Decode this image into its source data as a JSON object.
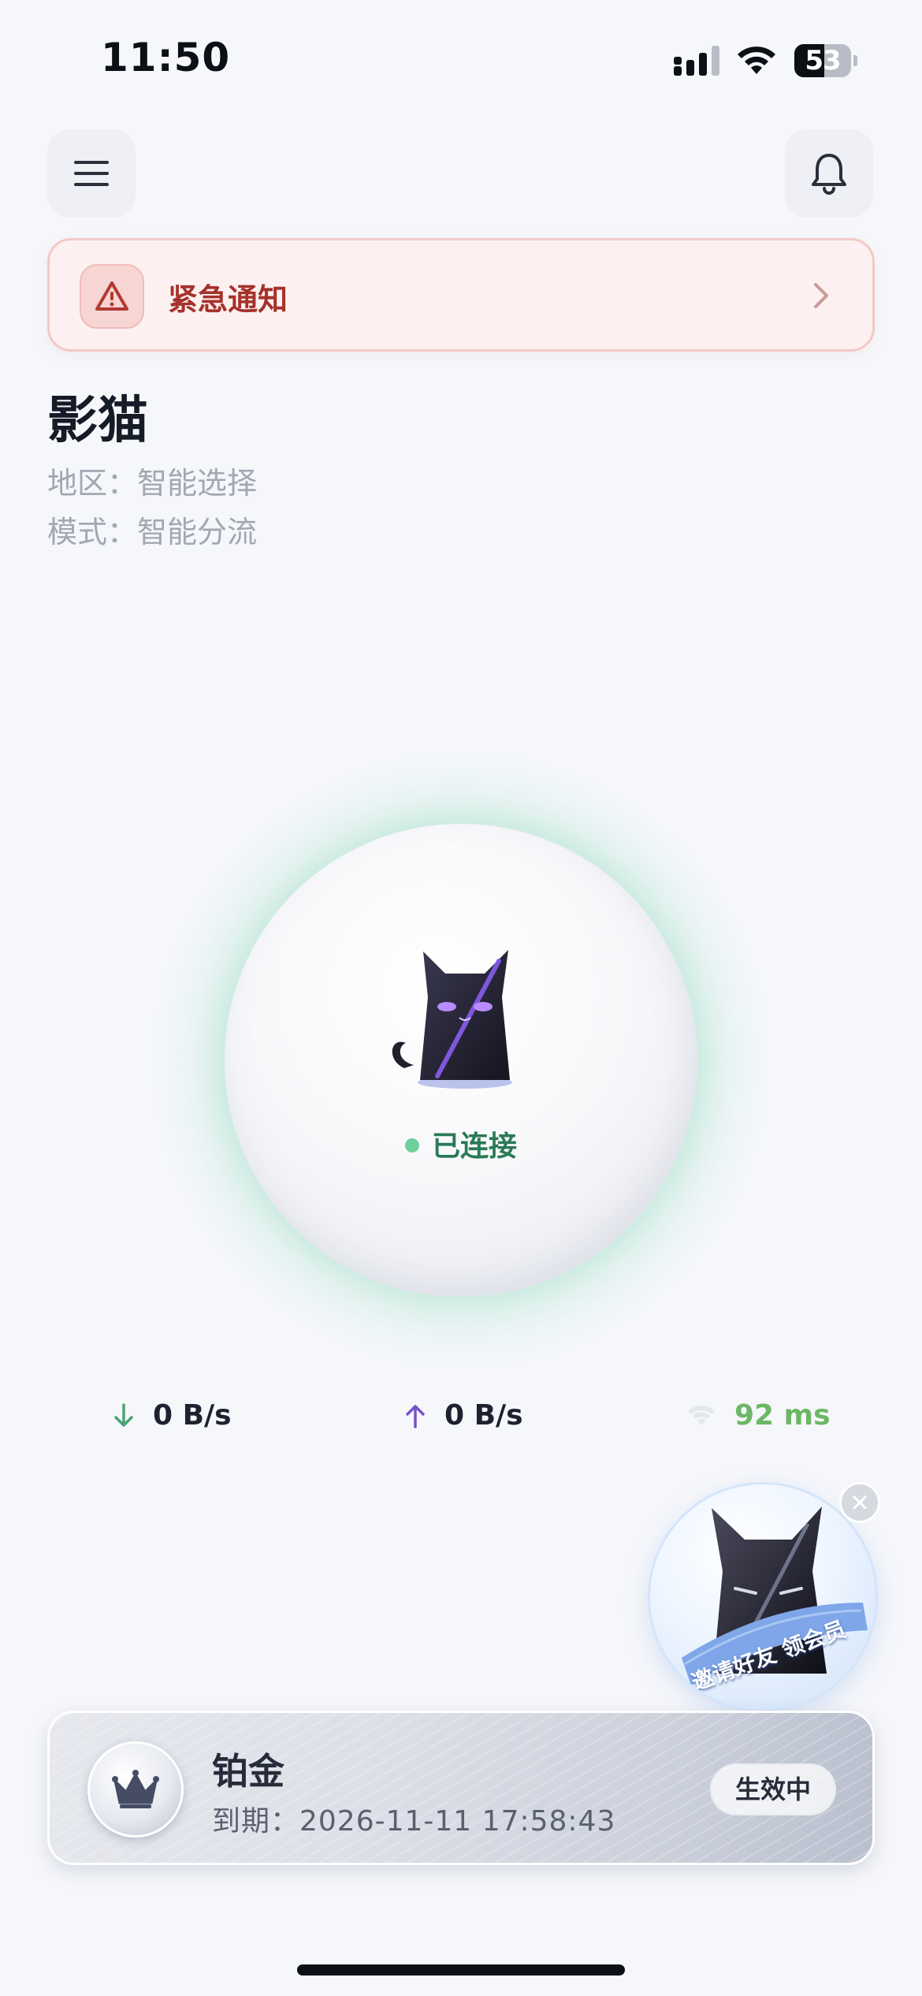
{
  "status_bar": {
    "time": "11:50",
    "battery_level": "53",
    "battery_percent": 53
  },
  "header": {
    "menu_icon": "hamburger-icon",
    "notification_icon": "bell-icon"
  },
  "alert": {
    "icon": "warning-triangle-icon",
    "label": "紧急通知"
  },
  "app": {
    "title": "影猫",
    "region": "地区：智能选择",
    "mode": "模式：智能分流"
  },
  "connection": {
    "status": "已连接",
    "status_color": "#6fcf9a"
  },
  "stats": {
    "download": "0 B/s",
    "upload": "0 B/s",
    "latency": "92 ms"
  },
  "promo": {
    "text": "邀请好友 领会员"
  },
  "membership": {
    "tier": "铂金",
    "expiry": "到期：2026-11-11 17:58:43",
    "badge": "生效中"
  },
  "colors": {
    "accent_green": "#6fcf9a",
    "alert_red": "#a5322b",
    "latency_green": "#6cb765",
    "upload_purple": "#7a52c7"
  }
}
